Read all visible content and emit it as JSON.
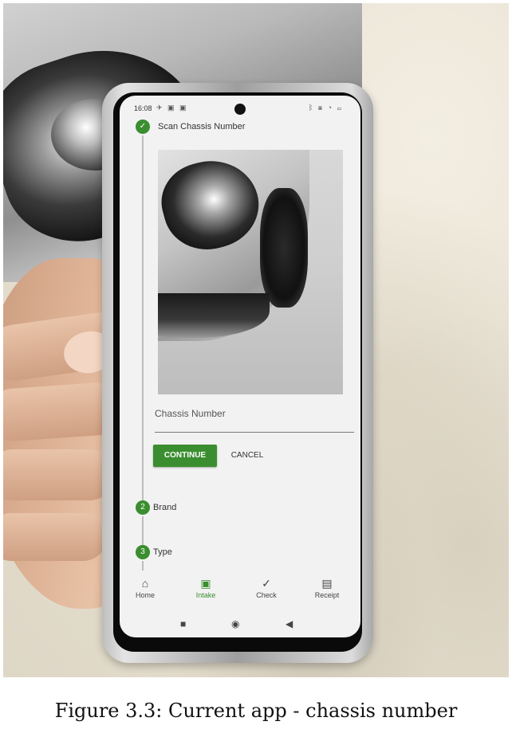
{
  "status_bar": {
    "time": "16:08"
  },
  "stepper": {
    "steps": [
      {
        "number": "✓",
        "label": "Scan Chassis Number"
      },
      {
        "number": "2",
        "label": "Brand"
      },
      {
        "number": "3",
        "label": "Type"
      }
    ]
  },
  "form": {
    "field_label": "Chassis Number",
    "continue_label": "CONTINUE",
    "cancel_label": "CANCEL"
  },
  "bottom_nav": {
    "items": [
      {
        "label": "Home",
        "icon": "home-icon"
      },
      {
        "label": "Intake",
        "icon": "inbox-icon",
        "active": true
      },
      {
        "label": "Check",
        "icon": "check-icon"
      },
      {
        "label": "Receipt",
        "icon": "receipt-icon"
      }
    ]
  },
  "caption": "Figure 3.3: Current app - chassis number",
  "colors": {
    "accent": "#3a8e2f"
  }
}
